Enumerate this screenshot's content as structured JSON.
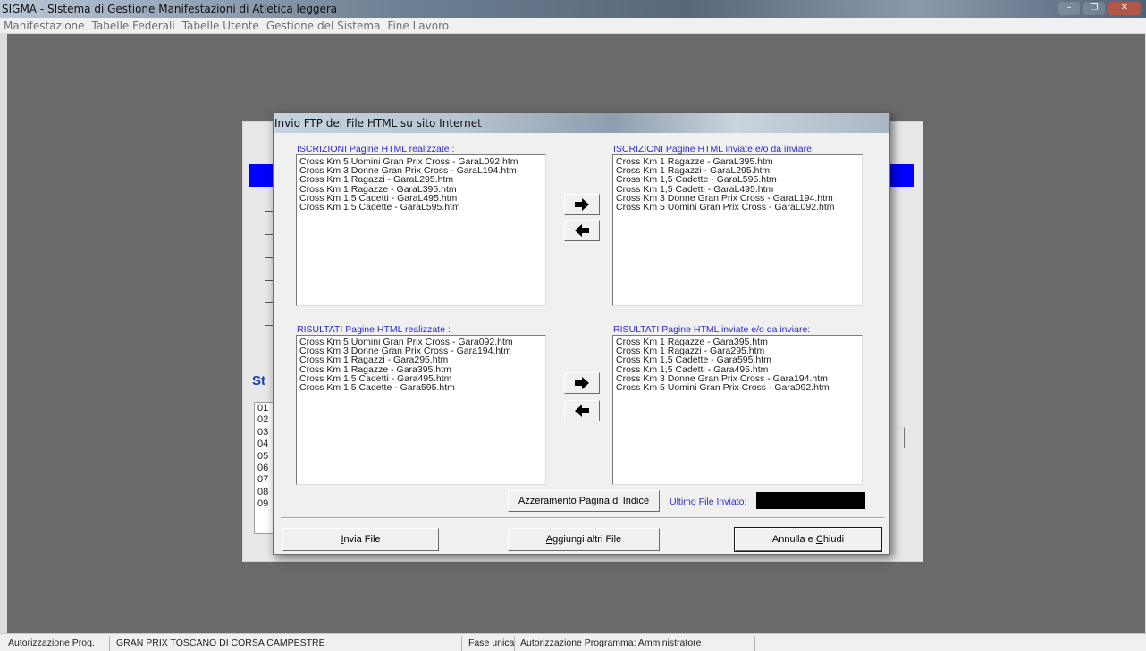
{
  "app": {
    "title": "SIGMA - SIstema di Gestione Manifestazioni di Atletica leggera",
    "window_controls": {
      "minimize": "–",
      "maximize": "❐",
      "close": "✕"
    }
  },
  "menubar": {
    "items": [
      {
        "label": "Manifestazione"
      },
      {
        "label": "Tabelle Federali"
      },
      {
        "label": "Tabelle Utente"
      },
      {
        "label": "Gestione del Sistema"
      },
      {
        "label": "Fine Lavoro"
      }
    ]
  },
  "background_form": {
    "section_label": "St",
    "list_items": [
      "01",
      "02",
      "03",
      "04",
      "05",
      "06",
      "07",
      "08",
      "09"
    ]
  },
  "dialog": {
    "title": "Invio FTP dei File HTML su sito Internet",
    "iscrizioni_realizzate": {
      "label": "ISCRIZIONI Pagine HTML realizzate :",
      "items": [
        "Cross Km 5 Uomini Gran Prix Cross - GaraL092.htm",
        "Cross Km 3 Donne Gran Prix Cross - GaraL194.htm",
        "Cross Km 1 Ragazzi - GaraL295.htm",
        "Cross Km 1 Ragazze - GaraL395.htm",
        "Cross Km 1,5 Cadetti - GaraL495.htm",
        "Cross Km 1,5 Cadette - GaraL595.htm"
      ]
    },
    "iscrizioni_inviate": {
      "label": "ISCRIZIONI Pagine HTML inviate e/o da inviare:",
      "items": [
        "Cross Km 1 Ragazze - GaraL395.htm",
        "Cross Km 1 Ragazzi - GaraL295.htm",
        "Cross Km 1,5 Cadette - GaraL595.htm",
        "Cross Km 1,5 Cadetti - GaraL495.htm",
        "Cross Km 3 Donne Gran Prix Cross - GaraL194.htm",
        "Cross Km 5 Uomini Gran Prix Cross - GaraL092.htm"
      ]
    },
    "risultati_realizzate": {
      "label": "RISULTATI Pagine HTML realizzate :",
      "items": [
        "Cross Km 5 Uomini Gran Prix Cross - Gara092.htm",
        "Cross Km 3 Donne Gran Prix Cross - Gara194.htm",
        "Cross Km 1 Ragazzi - Gara295.htm",
        "Cross Km 1 Ragazze - Gara395.htm",
        "Cross Km 1,5 Cadetti - Gara495.htm",
        "Cross Km 1,5 Cadette - Gara595.htm"
      ]
    },
    "risultati_inviate": {
      "label": "RISULTATI Pagine HTML inviate e/o da inviare:",
      "items": [
        "Cross Km 1 Ragazze - Gara395.htm",
        "Cross Km 1 Ragazzi - Gara295.htm",
        "Cross Km 1,5 Cadette - Gara595.htm",
        "Cross Km 1,5 Cadetti - Gara495.htm",
        "Cross Km 3 Donne Gran Prix Cross - Gara194.htm",
        "Cross Km 5 Uomini Gran Prix Cross - Gara092.htm"
      ]
    },
    "icons": {
      "move_right": "arrow-right-icon",
      "move_left": "arrow-left-icon"
    },
    "reset_index_button": {
      "accel": "A",
      "rest": "zzeramento Pagina di Indice"
    },
    "last_file_label": "Ultimo File Inviato:",
    "last_file_value": "",
    "send_button": {
      "accel": "I",
      "rest": "nvia File"
    },
    "add_files_button": {
      "accel": "A",
      "rest": "ggiungi altri File"
    },
    "cancel_button": {
      "pre": "Annulla e ",
      "accel": "C",
      "rest": "hiudi"
    }
  },
  "statusbar": {
    "panels": [
      "Autorizzazione Prog.",
      "GRAN PRIX TOSCANO DI CORSA CAMPESTRE",
      "Fase unica",
      "Autorizzazione Programma: Amministratore"
    ]
  },
  "colors": {
    "workspace": "#6a6a6a",
    "label_blue": "#2a2adb",
    "accent_blue": "#0000ff"
  }
}
